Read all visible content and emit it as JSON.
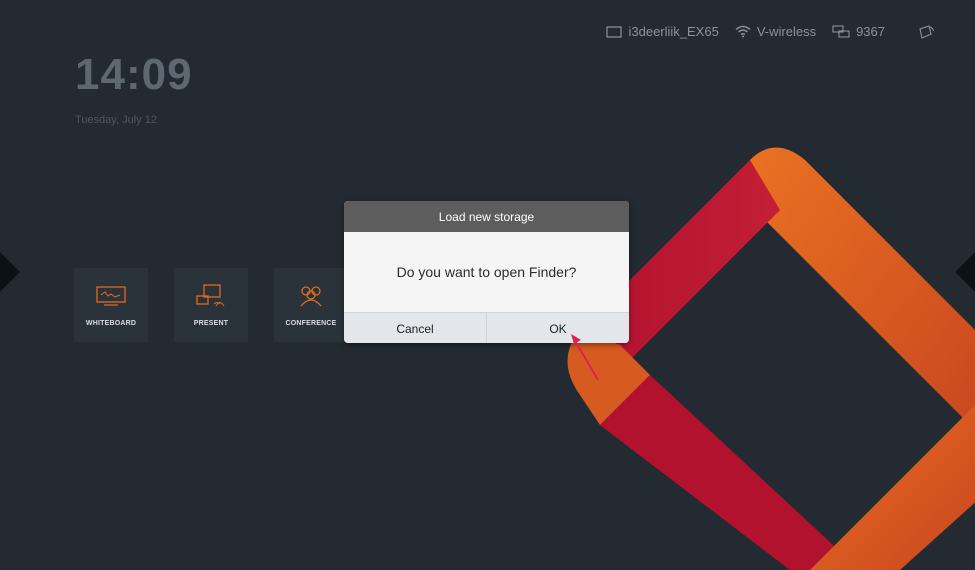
{
  "status": {
    "display_name": "i3deerliik_EX65",
    "wifi_name": "V-wireless",
    "code": "9367",
    "icons": [
      "display-icon",
      "wifi-icon",
      "network-icon",
      "cast-icon"
    ]
  },
  "clock": {
    "time": "14:09",
    "date": "Tuesday, July 12"
  },
  "tiles": [
    {
      "label": "WHITEBOARD",
      "icon": "whiteboard-icon"
    },
    {
      "label": "PRESENT",
      "icon": "present-icon"
    },
    {
      "label": "CONFERENCE",
      "icon": "conference-icon"
    }
  ],
  "dialog": {
    "title": "Load new storage",
    "message": "Do you want to open Finder?",
    "cancel_label": "Cancel",
    "ok_label": "OK"
  },
  "colors": {
    "background": "#232a31",
    "accent_orange": "#e26a1f",
    "accent_red": "#b3122e",
    "pointer": "#e0234e"
  }
}
